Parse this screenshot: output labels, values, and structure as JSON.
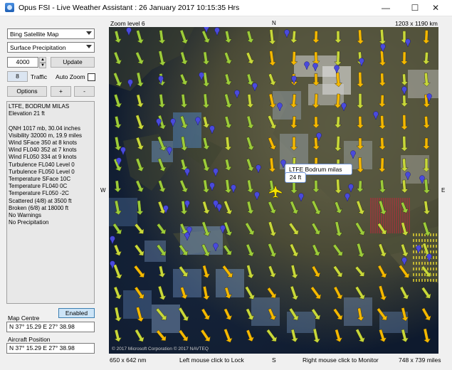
{
  "window": {
    "title": "Opus FSI - Live Weather Assistant : 26 January 2017  10:15:35 Hrs",
    "minimize": "—",
    "maximize": "☐",
    "close": "✕"
  },
  "controls": {
    "map_type": "Bing Satellite Map",
    "layer": "Surface Precipitation",
    "altitude": "4000",
    "update_label": "Update",
    "traffic_count": "8",
    "traffic_label": "Traffic",
    "auto_zoom_label": "Auto Zoom",
    "auto_zoom_checked": false,
    "options_label": "Options",
    "zoom_in_label": "+",
    "zoom_out_label": "-"
  },
  "info_lines": [
    "LTFE, BODRUM MILAS",
    "Elevation 21 ft",
    "",
    "QNH 1017 mb, 30.04 inches",
    "Visibility 32000 m, 19.9 miles",
    "Wind SFace 350 at 8 knots",
    "Wind FL040 352 at 7 knots",
    "Wind FL050 334 at 9 knots",
    "Turbulence FL040 Level 0",
    "Turbulence FL050 Level 0",
    "Temperature SFace 10C",
    "Temperature FL040 0C",
    "Temperature FL050 -2C",
    "Scattered (4/8) at 3500 ft",
    "Broken (6/8) at 18000 ft",
    "No Warnings",
    "No Precipitation"
  ],
  "map_centre": {
    "enabled_label": "Enabled",
    "label": "Map Centre",
    "value": "N 37° 15.29  E 27° 38.98"
  },
  "aircraft_position": {
    "label": "Aircraft Position",
    "value": "N 37° 15.29  E 27° 38.98"
  },
  "map": {
    "zoom_label": "Zoom level 6",
    "pixel_size": "1203 x 1190 km",
    "north": "N",
    "south": "S",
    "east": "E",
    "west": "W",
    "airport_popup": {
      "code_name": "LTFE  Bodrum milas",
      "elevation": "24 ft"
    },
    "copyright": "© 2017 Microsoft Corporation  © 2017 NAVTEQ"
  },
  "status": {
    "map_size": "650 x 642 nm",
    "left_hint": "Left mouse click to Lock",
    "south": "S",
    "right_hint": "Right mouse click to Monitor",
    "view_size": "748 x 739 miles"
  },
  "colors": {
    "arrow_yellow": "#f5b800",
    "arrow_lime": "#c8d83a",
    "arrow_green": "#9ccc3a",
    "pin": "#4a4adc",
    "rain_red": "#c8283c"
  }
}
